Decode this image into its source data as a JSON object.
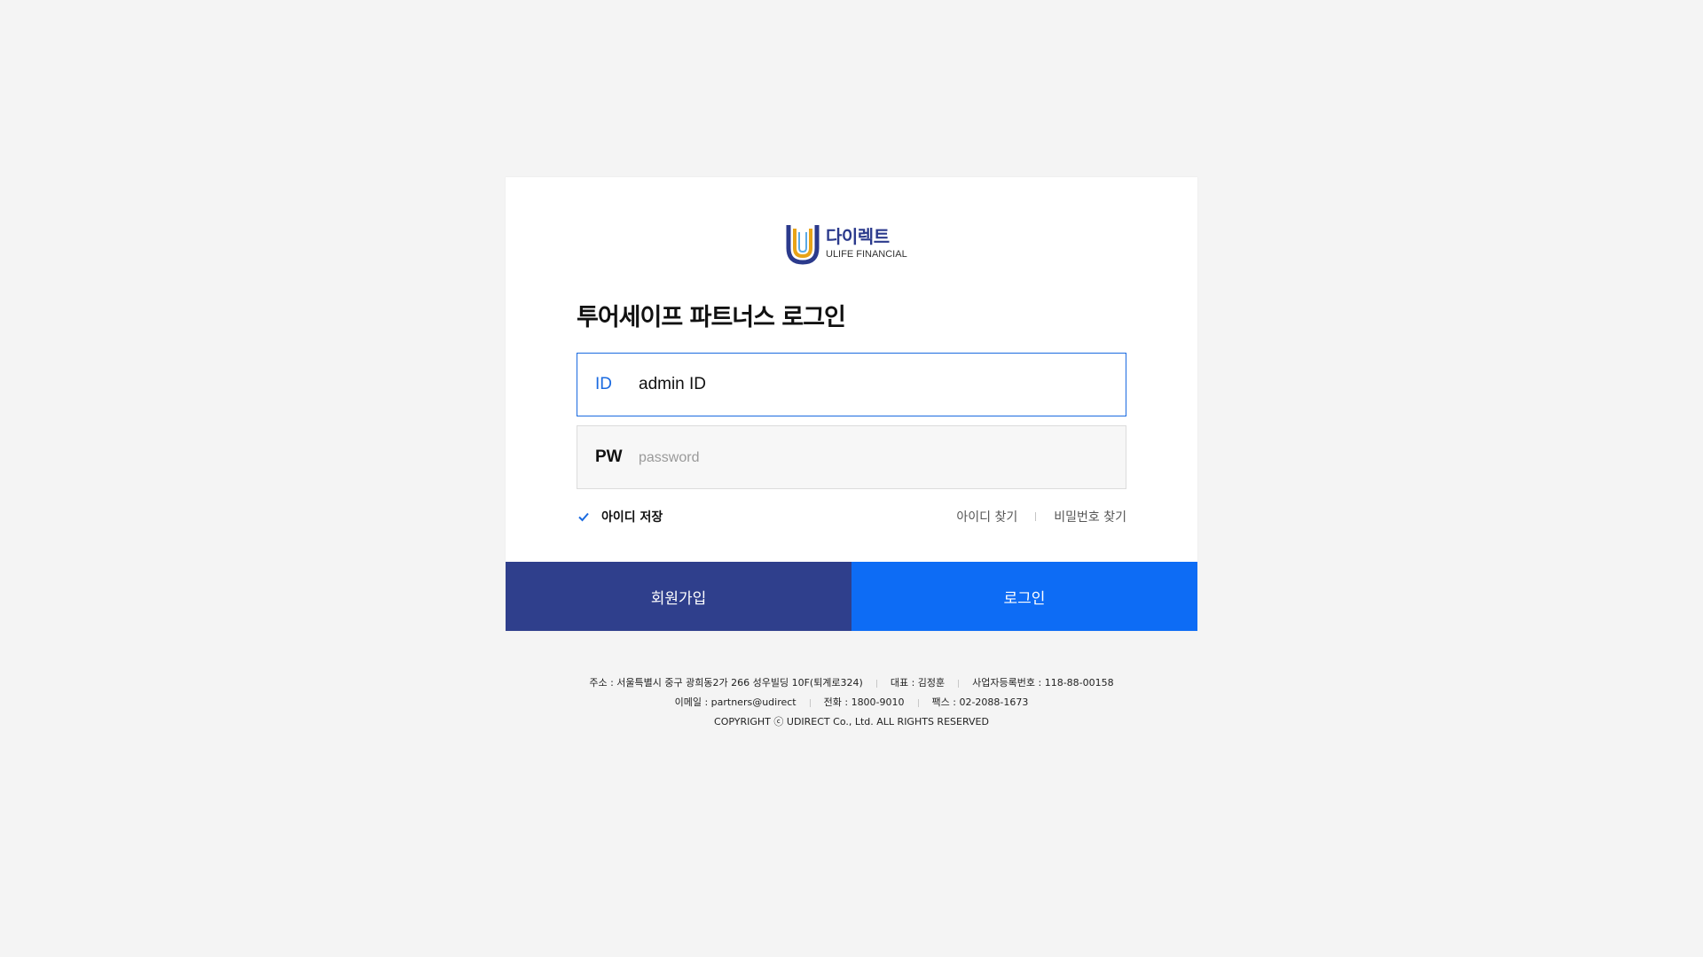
{
  "logo": {
    "korean_text": "다이렉트",
    "english_text": "ULIFE FINANCIAL",
    "icon": "ulife-u-logo-icon"
  },
  "title": "투어세이프 파트너스 로그인",
  "id_field": {
    "label": "ID",
    "value": "admin ID",
    "placeholder": ""
  },
  "pw_field": {
    "label": "PW",
    "value": "",
    "placeholder": "password"
  },
  "remember": {
    "label": "아이디 저장",
    "checked": true,
    "icon": "check-icon"
  },
  "links": {
    "find_id": "아이디 찾기",
    "find_pw": "비밀번호 찾기"
  },
  "buttons": {
    "signup": "회원가입",
    "login": "로그인"
  },
  "footer": {
    "address": "주소 : 서울특별시 중구 광희동2가 266 성우빌딩 10F(퇴계로324)",
    "ceo": "대표 : 김정훈",
    "biz_no": "사업자등록번호 : 118-88-00158",
    "email": "이메일 : partners@udirect",
    "phone": "전화 : 1800-9010",
    "fax": "팩스 : 02-2088-1673",
    "copyright": "COPYRIGHT ⓒ UDIRECT Co., Ltd. ALL RIGHTS RESERVED"
  },
  "colors": {
    "background": "#f4f4f4",
    "card": "#ffffff",
    "accent_blue": "#0d6cf5",
    "navy": "#2f3f8c",
    "logo_navy": "#2b3a8c",
    "logo_gold": "#e8a317",
    "id_border": "#1a6ae0"
  }
}
